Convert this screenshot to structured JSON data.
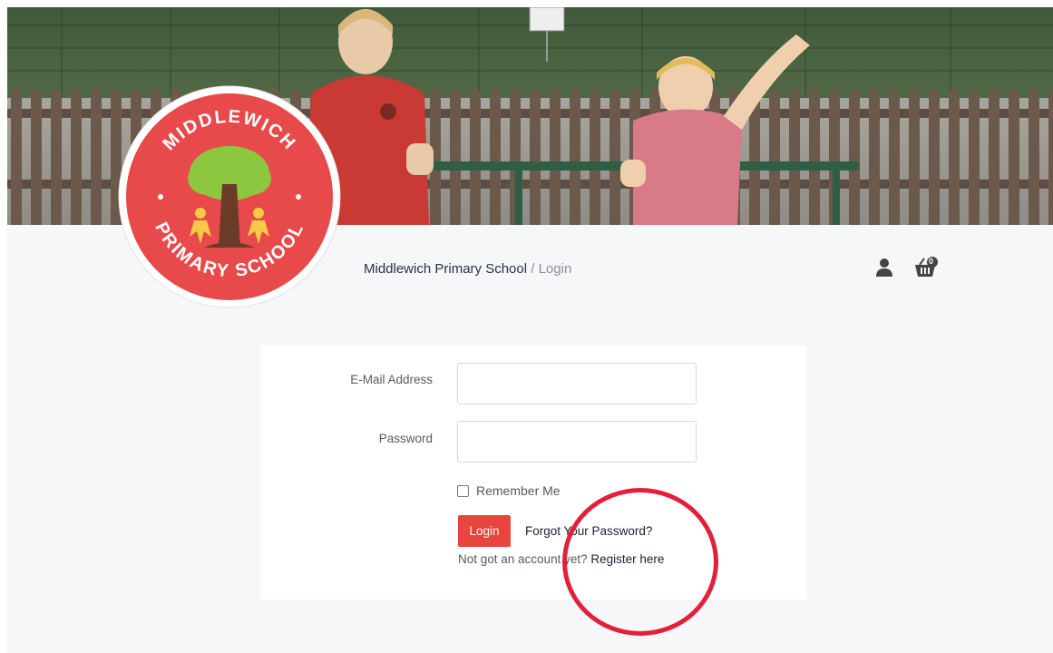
{
  "logo": {
    "arc_text_top": "MIDDLEWICH",
    "arc_text_bottom": "PRIMARY SCHOOL",
    "colors": {
      "ring": "#ffffff",
      "fill": "#e8494a",
      "tree_canopy": "#8dc63f",
      "trunk": "#6b3b2a",
      "figures": "#f7c948"
    }
  },
  "breadcrumb": {
    "home": "Middlewich Primary School",
    "separator": "/",
    "current": "Login"
  },
  "header_icons": [
    {
      "name": "account-icon",
      "badge": ""
    },
    {
      "name": "basket-icon",
      "badge": "0"
    }
  ],
  "login_form": {
    "email_label": "E-Mail Address",
    "email_value": "",
    "password_label": "Password",
    "password_value": "",
    "remember_label": "Remember Me",
    "remember_checked": false,
    "login_button": "Login",
    "forgot_link": "Forgot Your Password?",
    "register_prefix": "Not got an account yet?",
    "register_link": "Register here"
  },
  "colors": {
    "accent": "#e8453c",
    "annotation": "#e3203a",
    "page_bg": "#f6f7f9"
  }
}
